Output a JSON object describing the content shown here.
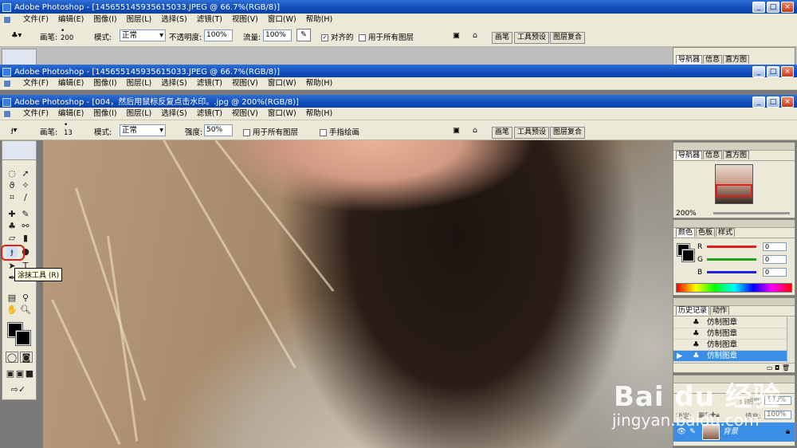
{
  "windows": [
    {
      "title": "Adobe Photoshop - [145655145935615033.JPEG @ 66.7%(RGB/8)]"
    },
    {
      "title": "Adobe Photoshop - [145655145935615033.JPEG @ 66.7%(RGB/8)]"
    },
    {
      "title": "Adobe Photoshop - [004，然后用鼠标反复点击水印。.jpg @ 200%(RGB/8)]"
    }
  ],
  "menu": [
    "文件(F)",
    "编辑(E)",
    "图像(I)",
    "图层(L)",
    "选择(S)",
    "滤镜(T)",
    "视图(V)",
    "窗口(W)",
    "帮助(H)"
  ],
  "options_back": {
    "brush_label": "画笔:",
    "brush_size": "200",
    "mode_label": "模式:",
    "mode_value": "正常",
    "opacity_label": "不透明度:",
    "opacity_value": "100%",
    "flow_label": "流量:",
    "flow_value": "100%",
    "aligned_label": "对齐的",
    "all_layers_label": "用于所有图层"
  },
  "options_front": {
    "brush_label": "画笔:",
    "brush_size": "13",
    "mode_label": "模式:",
    "mode_value": "正常",
    "strength_label": "强度:",
    "strength_value": "50%",
    "all_layers_label": "用于所有图层",
    "finger_label": "手指绘画"
  },
  "well_tabs": [
    "画笔",
    "工具预设",
    "图层复合"
  ],
  "tooltip": "涂抹工具 (R)",
  "navigator": {
    "tabs": [
      "导航器",
      "信息",
      "直方图"
    ],
    "zoom": "200%"
  },
  "color_panel": {
    "tabs": [
      "颜色",
      "色板",
      "样式"
    ],
    "channels": [
      {
        "label": "R",
        "value": "0",
        "color": "#e02020"
      },
      {
        "label": "G",
        "value": "0",
        "color": "#20a020"
      },
      {
        "label": "B",
        "value": "0",
        "color": "#2020e0"
      }
    ]
  },
  "history": {
    "tabs": [
      "历史记录",
      "动作"
    ],
    "items": [
      "仿制图章",
      "仿制图章",
      "仿制图章",
      "仿制图章"
    ],
    "selected_index": 3
  },
  "layers": {
    "opacity_label": "透明度:",
    "opacity_value": "100%",
    "lock_label": "锁定:",
    "fill_label": "填充:",
    "fill_value": "100%",
    "layer_name": "背景"
  },
  "watermark": {
    "logo": "Bai du 经验",
    "url": "jingyan.baidu.com"
  },
  "colors": {
    "title_blue": "#0f4bb8",
    "selected_blue": "#3a8ee6",
    "highlight_red": "#e02020"
  }
}
